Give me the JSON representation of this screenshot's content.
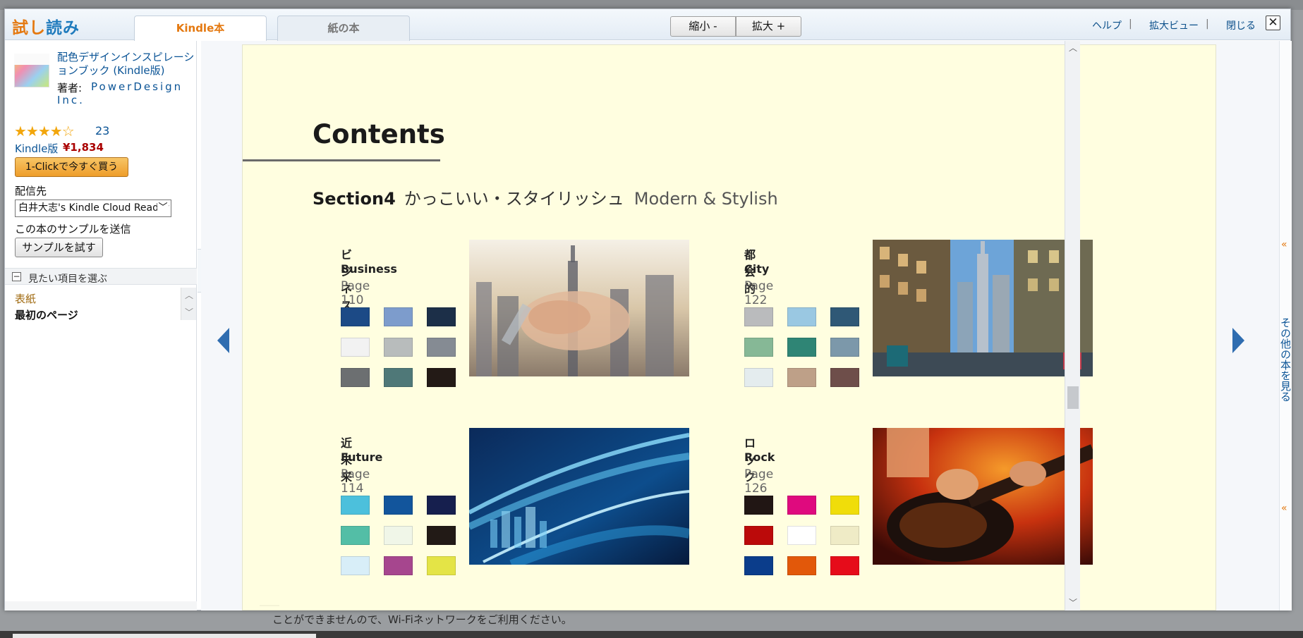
{
  "header": {
    "logo_part1": "試し",
    "logo_part2": "読み",
    "tabs": [
      {
        "label": "Kindle本"
      },
      {
        "label": "紙の本"
      }
    ],
    "zoom_out": "縮小 -",
    "zoom_in": "拡大 +",
    "help": "ヘルプ",
    "zoom_view": "拡大ビュー",
    "close": "閉じる",
    "separator": "|"
  },
  "book": {
    "title": "配色デザインインスピレーションブック (Kindle版)",
    "author_label": "著者:",
    "author": "PowerDesign Inc.",
    "rating_count": "23",
    "stars": "★★★★☆",
    "format": "Kindle版",
    "price": "¥1,834",
    "buy_button": "1-Clickで今すぐ買う",
    "deliver_label": "配信先",
    "deliver_value": "白井大志's Kindle Cloud Reader",
    "send_label": "この本のサンプルを送信",
    "try_button": "サンプルを試す"
  },
  "toc": {
    "heading": "見たい項目を選ぶ",
    "items": [
      {
        "label": "表紙"
      },
      {
        "label": "最初のページ"
      }
    ]
  },
  "page": {
    "title": "Contents",
    "section_label": "Section4",
    "section_jp": "かっこいい・スタイリッシュ",
    "section_en": "Modern & Stylish",
    "themes": [
      {
        "jp": "ビジネス",
        "en": "Business",
        "page": "Page 110",
        "swatches": [
          "#1c4a86",
          "#7d9ccc",
          "#1c2f48",
          "#f2f2f2",
          "#b8bcbc",
          "#858b93",
          "#6c6f71",
          "#4f7878",
          "#231a16"
        ]
      },
      {
        "jp": "都会的",
        "en": "City",
        "page": "Page 122",
        "swatches": [
          "#babbbd",
          "#9ac8e2",
          "#2f5876",
          "#86b896",
          "#2f8575",
          "#7c98aa",
          "#e4ecee",
          "#bea088",
          "#6e4e4a"
        ]
      },
      {
        "jp": "近未来",
        "en": "Future",
        "page": "Page 114",
        "swatches": [
          "#4cc0dc",
          "#12559c",
          "#161f4e",
          "#53bea6",
          "#f0f6e8",
          "#221a16",
          "#d8eef8",
          "#a6468e",
          "#e4e446"
        ]
      },
      {
        "jp": "ロック",
        "en": "Rock",
        "page": "Page 126",
        "swatches": [
          "#211614",
          "#df0a7e",
          "#f0dd0a",
          "#bb0a0a",
          "#ffffff",
          "#efebc6",
          "#0b3d8b",
          "#e2580a",
          "#e60c1a"
        ]
      }
    ]
  },
  "right_strip": {
    "more_books": "その他の本を見る"
  },
  "backdrop": {
    "text": "ことができませんので、Wi-Fiネットワークをご利用ください。"
  },
  "colors": {
    "accent_orange": "#e47911",
    "link_blue": "#0b5496",
    "price_red": "#aa0000",
    "page_bg": "#fffee0"
  }
}
